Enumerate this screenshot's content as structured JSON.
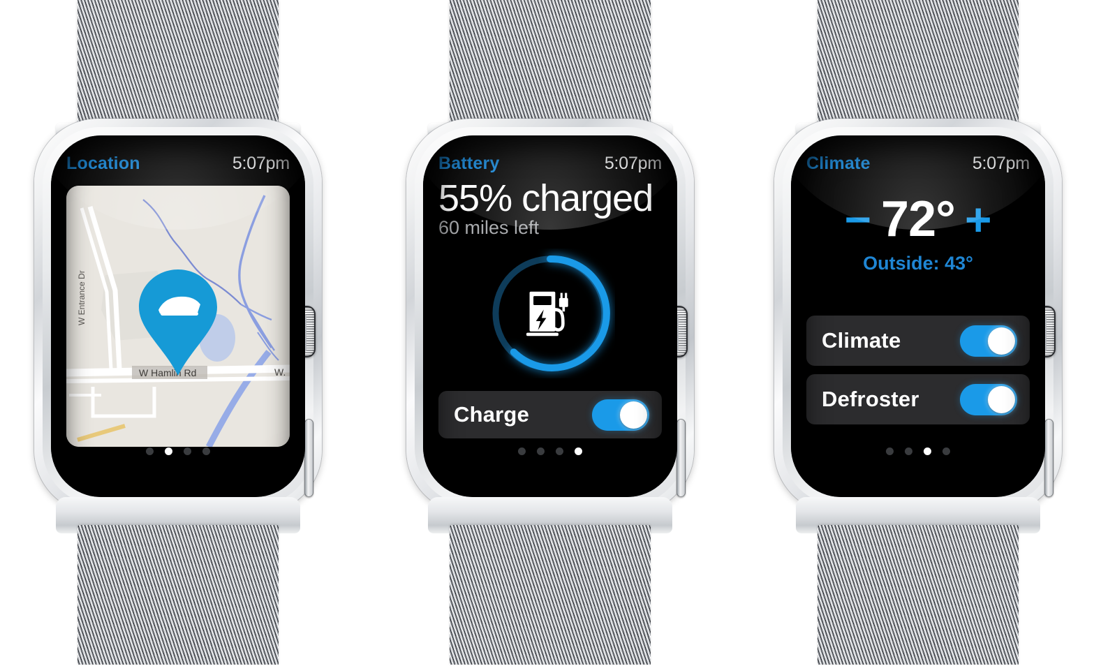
{
  "theme": {
    "accent_blue": "#1a9ae8",
    "title_blue": "#1485d6",
    "screen_bg": "#000000",
    "row_bg": "#2c2c2e",
    "subtext_gray": "#a9abae"
  },
  "watches": [
    {
      "id": "location",
      "app_title": "Location",
      "clock": "5:07pm",
      "page_dots": {
        "count": 4,
        "active_index": 1
      },
      "map": {
        "pin_icon": "car-pin-icon",
        "background_color": "#e9e6e0",
        "labels": [
          {
            "text": "W Entrance Dr",
            "orientation": "vertical"
          },
          {
            "text": "W Hamlin Rd",
            "orientation": "horizontal"
          },
          {
            "text": "W.",
            "orientation": "horizontal"
          }
        ]
      }
    },
    {
      "id": "battery",
      "app_title": "Battery",
      "clock": "5:07pm",
      "page_dots": {
        "count": 4,
        "active_index": 3
      },
      "headline": "55% charged",
      "subhead": "60 miles left",
      "ring": {
        "percent": 57,
        "icon": "charging-station-icon",
        "track_color": "#0f3f5e",
        "fill_color": "#1a9ae8"
      },
      "toggle": {
        "label": "Charge",
        "state": "on"
      }
    },
    {
      "id": "climate",
      "app_title": "Climate",
      "clock": "5:07pm",
      "page_dots": {
        "count": 4,
        "active_index": 2
      },
      "temperature": {
        "decrement_label": "−",
        "value": "72°",
        "increment_label": "+"
      },
      "outside_label": "Outside: 43°",
      "toggles": [
        {
          "label": "Climate",
          "state": "on"
        },
        {
          "label": "Defroster",
          "state": "on"
        }
      ]
    }
  ]
}
